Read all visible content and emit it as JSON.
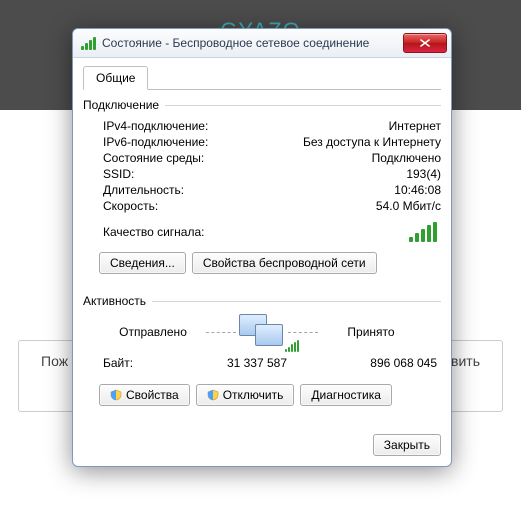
{
  "background": {
    "logo": "GYAZO",
    "left_text": "Пож",
    "right_text": "вить"
  },
  "window": {
    "title": "Состояние - Беспроводное сетевое соединение"
  },
  "tab": {
    "label": "Общие"
  },
  "connection": {
    "group_title": "Подключение",
    "rows": {
      "ipv4_label": "IPv4-подключение:",
      "ipv4_value": "Интернет",
      "ipv6_label": "IPv6-подключение:",
      "ipv6_value": "Без доступа к Интернету",
      "media_label": "Состояние среды:",
      "media_value": "Подключено",
      "ssid_label": "SSID:",
      "ssid_value": "193(4)",
      "duration_label": "Длительность:",
      "duration_value": "10:46:08",
      "speed_label": "Скорость:",
      "speed_value": "54.0 Мбит/с",
      "signal_label": "Качество сигнала:"
    },
    "buttons": {
      "details": "Сведения...",
      "wireless_props": "Свойства беспроводной сети"
    }
  },
  "activity": {
    "group_title": "Активность",
    "sent_label": "Отправлено",
    "received_label": "Принято",
    "bytes_label": "Байт:",
    "bytes_sent": "31 337 587",
    "bytes_received": "896 068 045",
    "buttons": {
      "properties": "Свойства",
      "disable": "Отключить",
      "diagnose": "Диагностика"
    }
  },
  "footer": {
    "close": "Закрыть"
  }
}
